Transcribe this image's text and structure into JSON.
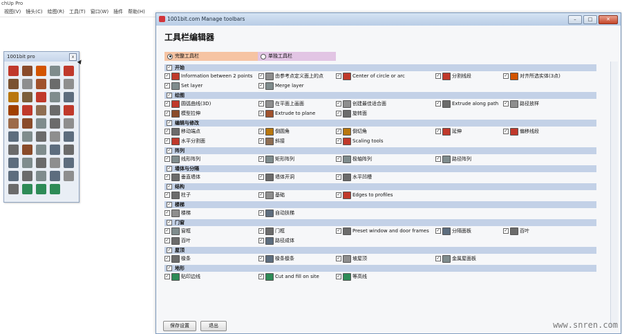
{
  "app": {
    "title": "chUp Pro",
    "menu": [
      "视图(V)",
      "镜头(C)",
      "绘图(R)",
      "工具(T)",
      "窗口(W)",
      "插件",
      "帮助(H)"
    ]
  },
  "palette": {
    "title": "1001bit pro",
    "close": "x",
    "icon_colors": [
      "#c0392b",
      "#8a4b2a",
      "#d35400",
      "#7f8c8d",
      "#c0392b",
      "#7a5230",
      "#8e8e8e",
      "#a0522d",
      "#6b6b6b",
      "#8e8e8e",
      "#b9770e",
      "#7b5e3b",
      "#c0392b",
      "#7f8c8d",
      "#5d6d7e",
      "#a04000",
      "#c0392b",
      "#8e6e53",
      "#6b6b6b",
      "#c0392b",
      "#9c6b4a",
      "#8a4b2a",
      "#7f8c8d",
      "#6b6b6b",
      "#8e8e8e",
      "#5d6d7e",
      "#7f8c8d",
      "#6b6b6b",
      "#8e8e8e",
      "#5d6d7e",
      "#6b6b6b",
      "#8a4b2a",
      "#7f8c8d",
      "#5d6d7e",
      "#6b6b6b",
      "#5d6d7e",
      "#7f8c8d",
      "#6b6b6b",
      "#8e8e8e",
      "#5d6d7e",
      "#5d6d7e",
      "#6b6b6b",
      "#7f8c8d",
      "#5d6d7e",
      "#8e8e8e",
      "#6b6b6b",
      "#2e8b57",
      "#2e8b57",
      "#2e8b57"
    ]
  },
  "dialog": {
    "title": "1001bit.com Manage toolbars",
    "heading": "工具栏编辑器",
    "modes": {
      "full": "完整工具栏",
      "single": "单独工具栏"
    },
    "save_label": "保存设置",
    "exit_label": "退出",
    "check": "✓",
    "categories": [
      {
        "name": "开始",
        "rows": [
          [
            {
              "label": "Information between 2 points",
              "color": "#c0392b"
            },
            {
              "label": "由参考点定义面上的点",
              "color": "#8e8e8e"
            },
            {
              "label": "Center of circle or arc",
              "color": "#c0392b"
            },
            {
              "label": "分割线段",
              "color": "#c0392b"
            },
            {
              "label": "对齐所选实体(3点)",
              "color": "#d35400"
            }
          ],
          [
            {
              "label": "Set layer",
              "color": "#7f8c8d"
            },
            {
              "label": "Merge layer",
              "color": "#7f8c8d"
            }
          ]
        ]
      },
      {
        "name": "绘图",
        "rows": [
          [
            {
              "label": "圆弧曲线(3D)",
              "color": "#c0392b"
            },
            {
              "label": "在平面上画面",
              "color": "#8e8e8e"
            },
            {
              "label": "创建最佳适合面",
              "color": "#8e8e8e"
            },
            {
              "label": "Extrude along path",
              "color": "#6b6b6b"
            },
            {
              "label": "路径放样",
              "color": "#8e8e8e"
            }
          ],
          [
            {
              "label": "模型拉伸",
              "color": "#8a4b2a"
            },
            {
              "label": "Extrude to plane",
              "color": "#a0522d"
            },
            {
              "label": "旋转面",
              "color": "#6b6b6b"
            }
          ]
        ]
      },
      {
        "name": "编辑与修改",
        "rows": [
          [
            {
              "label": "移动端点",
              "color": "#6b6b6b"
            },
            {
              "label": "倒圆角",
              "color": "#b9770e"
            },
            {
              "label": "倒切角",
              "color": "#b9770e"
            },
            {
              "label": "延伸",
              "color": "#c0392b"
            },
            {
              "label": "偏移线段",
              "color": "#c0392b"
            }
          ],
          [
            {
              "label": "水平分割面",
              "color": "#c0392b"
            },
            {
              "label": "斜接",
              "color": "#8e6e53"
            },
            {
              "label": "Scaling tools",
              "color": "#c0392b"
            }
          ]
        ]
      },
      {
        "name": "阵列",
        "rows": [
          [
            {
              "label": "线形阵列",
              "color": "#7f8c8d"
            },
            {
              "label": "矩形阵列",
              "color": "#7f8c8d"
            },
            {
              "label": "极轴阵列",
              "color": "#7f8c8d"
            },
            {
              "label": "路径阵列",
              "color": "#7f8c8d"
            }
          ]
        ]
      },
      {
        "name": "墙体与分隔",
        "rows": [
          [
            {
              "label": "垂直墙体",
              "color": "#6b6b6b"
            },
            {
              "label": "墙体开洞",
              "color": "#6b6b6b"
            },
            {
              "label": "水平凹槽",
              "color": "#6b6b6b"
            }
          ]
        ]
      },
      {
        "name": "结构",
        "rows": [
          [
            {
              "label": "柱子",
              "color": "#6b6b6b"
            },
            {
              "label": "基础",
              "color": "#8e8e8e"
            },
            {
              "label": "Edges to profiles",
              "color": "#c0392b"
            }
          ]
        ]
      },
      {
        "name": "楼梯",
        "rows": [
          [
            {
              "label": "楼梯",
              "color": "#8e8e8e"
            },
            {
              "label": "自动扶梯",
              "color": "#5d6d7e"
            }
          ]
        ]
      },
      {
        "name": "门窗",
        "rows": [
          [
            {
              "label": "窗框",
              "color": "#7f8c8d"
            },
            {
              "label": "门框",
              "color": "#6b6b6b"
            },
            {
              "label": "Preset window and door frames",
              "color": "#6b6b6b"
            },
            {
              "label": "分隔面板",
              "color": "#5d6d7e"
            },
            {
              "label": "百叶",
              "color": "#6b6b6b"
            }
          ],
          [
            {
              "label": "百叶",
              "color": "#6b6b6b"
            },
            {
              "label": "路径成体",
              "color": "#5d6d7e"
            }
          ]
        ]
      },
      {
        "name": "屋顶",
        "rows": [
          [
            {
              "label": "椽条",
              "color": "#6b6b6b"
            },
            {
              "label": "椽条檩条",
              "color": "#5d6d7e"
            },
            {
              "label": "坡屋顶",
              "color": "#8e8e8e"
            },
            {
              "label": "金属屋面板",
              "color": "#7f8c8d"
            }
          ]
        ]
      },
      {
        "name": "地形",
        "rows": [
          [
            {
              "label": "贴印边线",
              "color": "#2e8b57"
            },
            {
              "label": "Cut and fill on site",
              "color": "#2e8b57"
            },
            {
              "label": "等高线",
              "color": "#2e8b57"
            }
          ]
        ]
      }
    ]
  },
  "watermark": "www.snren.com"
}
